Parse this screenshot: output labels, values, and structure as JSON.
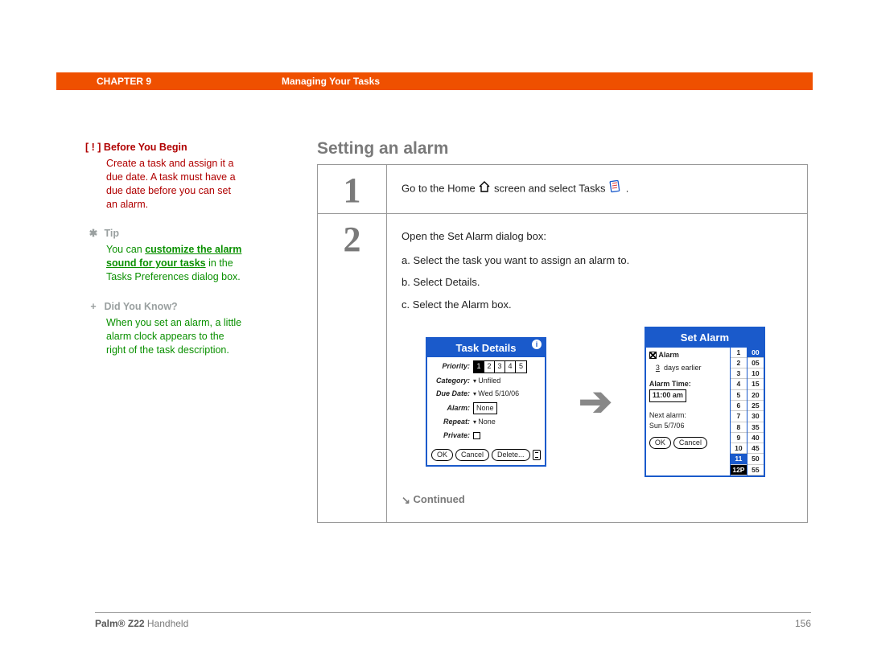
{
  "header": {
    "chapter": "CHAPTER 9",
    "section": "Managing Your Tasks"
  },
  "sidebar": {
    "before": {
      "marker": "[ ! ]",
      "title": "Before You Begin",
      "body": "Create a task and assign it a due date. A task must have a due date before you can set an alarm."
    },
    "tip": {
      "marker": "✱",
      "title": "Tip",
      "pre": "You can ",
      "link": "customize the alarm sound for your tasks",
      "post": " in the Tasks Preferences dialog box."
    },
    "dyk": {
      "marker": "+",
      "title": "Did You Know?",
      "body": "When you set an alarm, a little alarm clock appears to the right of the task description."
    }
  },
  "main": {
    "title": "Setting an alarm",
    "step1": {
      "num": "1",
      "text_a": "Go to the Home ",
      "text_b": " screen and select Tasks ",
      "text_c": " ."
    },
    "step2": {
      "num": "2",
      "intro": "Open the Set Alarm dialog box:",
      "a": "a.  Select the task you want to assign an alarm to.",
      "b": "b.  Select Details.",
      "c": "c.  Select the Alarm box.",
      "continued": "Continued"
    }
  },
  "task_details": {
    "title": "Task Details",
    "priority_lab": "Priority:",
    "priority_opts": [
      "1",
      "2",
      "3",
      "4",
      "5"
    ],
    "category_lab": "Category:",
    "category_val": "Unfiled",
    "due_lab": "Due Date:",
    "due_val": "Wed 5/10/06",
    "alarm_lab": "Alarm:",
    "alarm_val": "None",
    "repeat_lab": "Repeat:",
    "repeat_val": "None",
    "private_lab": "Private:",
    "ok": "OK",
    "cancel": "Cancel",
    "delete": "Delete..."
  },
  "set_alarm": {
    "title": "Set Alarm",
    "alarm_lab": "Alarm",
    "days_val": "3",
    "days_txt": "days earlier",
    "time_lab": "Alarm Time:",
    "time_val": "11:00 am",
    "next_lab": "Next alarm:",
    "next_val": "Sun 5/7/06",
    "ok": "OK",
    "cancel": "Cancel",
    "hours": [
      "1",
      "2",
      "3",
      "4",
      "5",
      "6",
      "7",
      "8",
      "9",
      "10",
      "11",
      "12P"
    ],
    "mins": [
      "00",
      "05",
      "10",
      "15",
      "20",
      "25",
      "30",
      "35",
      "40",
      "45",
      "50",
      "55"
    ]
  },
  "footer": {
    "brand": "Palm® Z22",
    "tail": " Handheld",
    "page": "156"
  }
}
